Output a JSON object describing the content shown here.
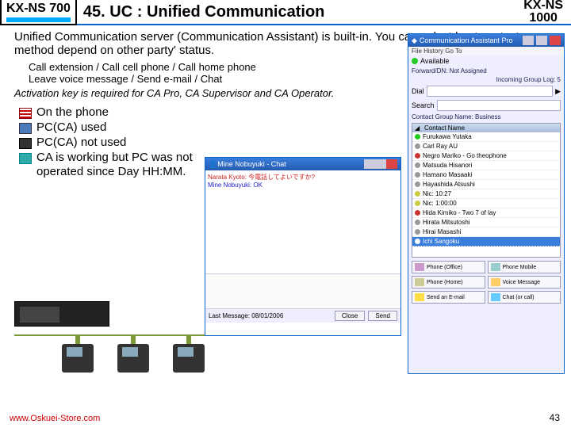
{
  "header": {
    "badge_left": "KX-NS 700",
    "title": "45. UC : Unified Communication",
    "badge_right_l1": "KX-NS",
    "badge_right_l2": "1000"
  },
  "body": {
    "para1": "Unified Communication server (Communication Assistant) is built-in. You can select best contact method depend on other party' status.",
    "methods": "Call extension / Call cell phone / Call home phone\nLeave voice message / Send e-mail / Chat",
    "note": "Activation key is required for CA Pro, CA Supervisor and CA Operator."
  },
  "legend": {
    "i1": "On the phone",
    "i2": "PC(CA) used",
    "i3": "PC(CA) not used",
    "i4": "CA is working but PC was not operated since Day HH:MM."
  },
  "ca": {
    "title": "Communication Assistant Pro",
    "menu": "File   History   Go To",
    "status": "Available",
    "fwd": "Forward/DN: Not Assigned",
    "grp": "Incoming Group Log: 5",
    "dial_label": "Dial",
    "search_label": "Search",
    "group_label": "Contact Group Name:",
    "group_value": "Business",
    "list_header": "Contact Name",
    "contacts": [
      {
        "n": "Furukawa Yutaka",
        "c": "#2c2"
      },
      {
        "n": "Carl Ray AU",
        "c": "#999"
      },
      {
        "n": "Negro Mariko - Go theophone",
        "c": "#c33"
      },
      {
        "n": "Matsuda Hisanori",
        "c": "#999"
      },
      {
        "n": "Hamano Masaaki",
        "c": "#999"
      },
      {
        "n": "Hayashida Atsushi",
        "c": "#999"
      },
      {
        "n": "Nic: 10:27",
        "c": "#cc4"
      },
      {
        "n": "Nic: 1:00:00",
        "c": "#cc4"
      },
      {
        "n": "Hida Kimiko - Two 7 of lay",
        "c": "#c33"
      },
      {
        "n": "Hirata Mitsutoshi",
        "c": "#999"
      },
      {
        "n": "Hirai Masashi",
        "c": "#999"
      },
      {
        "n": "Ichi Sangoku",
        "c": "#fff"
      }
    ],
    "actions": {
      "a1": "Phone (Office)",
      "a2": "Phone Mobile",
      "a3": "Phone (Home)",
      "a4": "Voice Message",
      "a5": "Send an E-mail",
      "a6": "Chat (or call)"
    }
  },
  "chat": {
    "title": "Mine Nobuyuki - Chat",
    "line1": "Narata Kyoto: 今電話してよいですか?",
    "line2": "Mine Nobuyuki: OK",
    "ts": "Last Message: 08/01/2006",
    "btn1": "Close",
    "btn2": "Send"
  },
  "footer": {
    "url": "www.Oskuei-Store.com",
    "page": "43"
  }
}
